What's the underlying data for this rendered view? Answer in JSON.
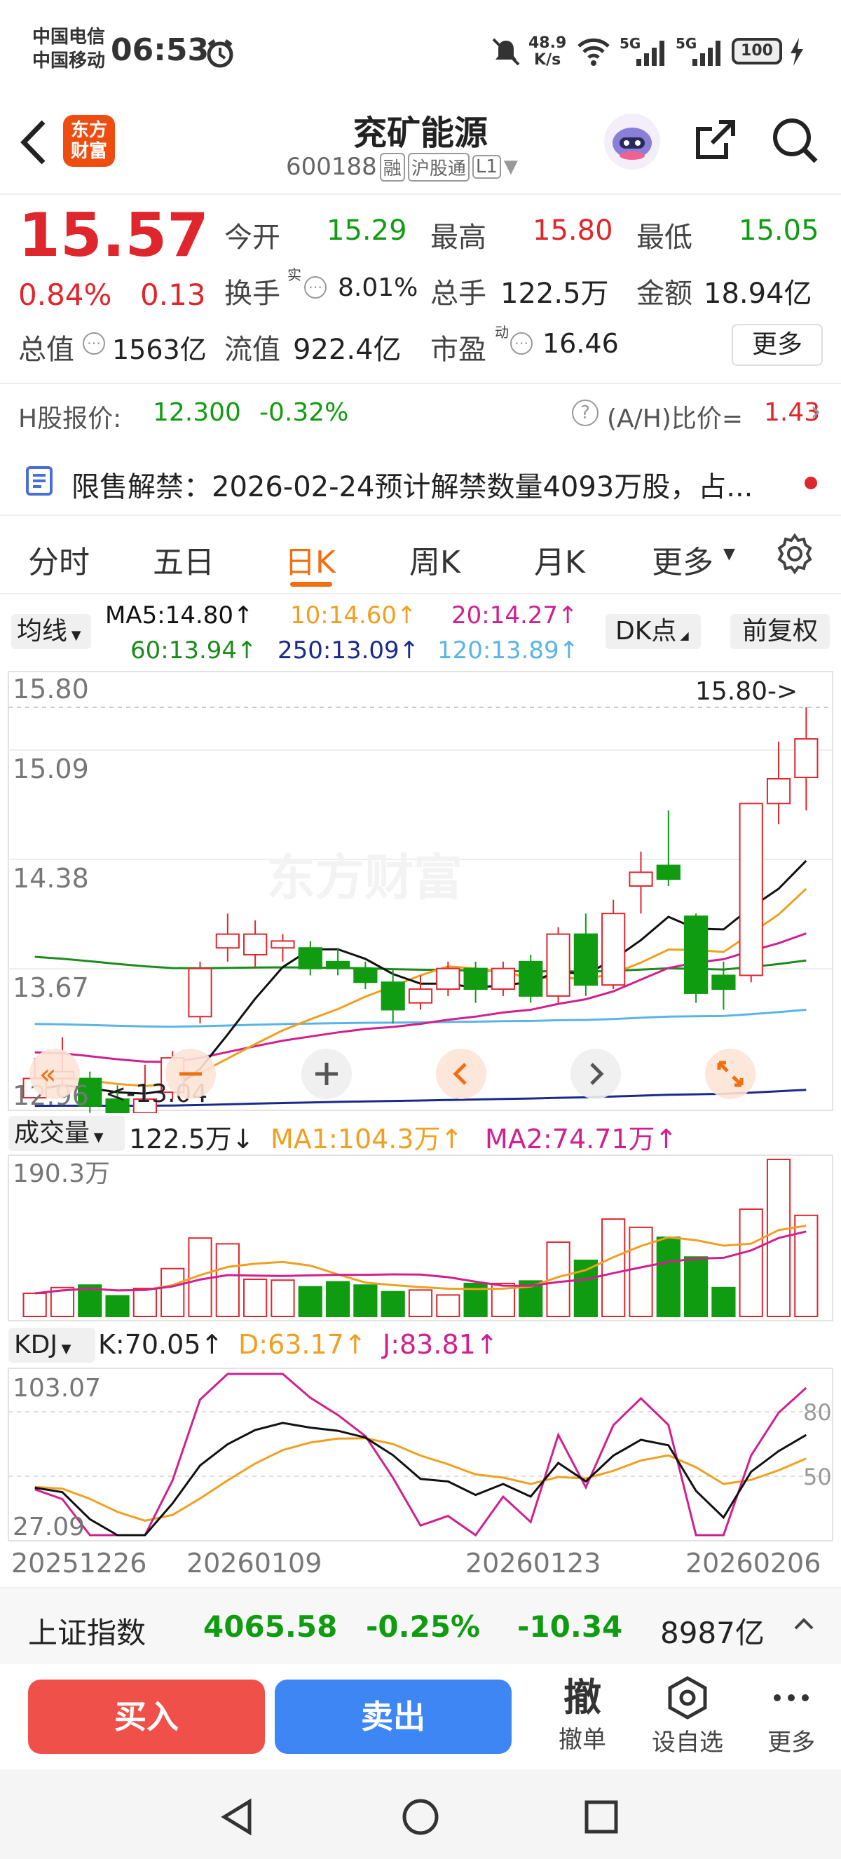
{
  "status": {
    "carrier1": "中国电信",
    "carrier2": "中国移动",
    "time": "06:53",
    "net_speed_value": "48.9",
    "net_speed_unit": "K/s",
    "battery": "100",
    "signal1": "5G",
    "signal2": "5G"
  },
  "nav": {
    "logo_line1": "东方",
    "logo_line2": "财富",
    "stock_name": "兖矿能源",
    "stock_code": "600188",
    "badge_rong": "融",
    "badge_hgt": "沪股通",
    "badge_l1": "L1"
  },
  "quote": {
    "price": "15.57",
    "change_pct": "0.84%",
    "change": "0.13",
    "open_label": "今开",
    "open": "15.29",
    "high_label": "最高",
    "high": "15.80",
    "low_label": "最低",
    "low": "15.05",
    "turnover_label": "换手",
    "turnover_sup": "实",
    "turnover": "8.01%",
    "volume_label": "总手",
    "volume": "122.5万",
    "amount_label": "金额",
    "amount": "18.94亿",
    "mktcap_label": "总值",
    "mktcap": "1563亿",
    "float_label": "流值",
    "float_cap": "922.4亿",
    "pe_label": "市盈",
    "pe_sup": "动",
    "pe": "16.46",
    "more_btn": "更多"
  },
  "hshare": {
    "label": "H股报价:",
    "price": "12.300",
    "change": "-0.32%",
    "ratio_label": "(A/H)比价=",
    "ratio": "1.43"
  },
  "notice": {
    "text": "限售解禁：2026-02-24预计解禁数量4093万股，占..."
  },
  "tabs": {
    "items": [
      "分时",
      "五日",
      "日K",
      "周K",
      "月K",
      "更多"
    ],
    "active": "日K"
  },
  "ma_legend": {
    "selector": "均线",
    "ma5": "MA5:14.80↑",
    "ma10": "10:14.60↑",
    "ma20": "20:14.27↑",
    "ma60": "60:13.94↑",
    "ma250": "250:13.09↑",
    "ma120": "120:13.89↑",
    "dk_btn": "DK点",
    "fq_btn": "前复权"
  },
  "chart_labels": {
    "y_top": "15.80",
    "y_2": "15.09",
    "y_3": "14.38",
    "y_4": "13.67",
    "y_bottom": "12.96",
    "high_mark": "15.80->",
    "low_mark": "<-13.04",
    "watermark": "东方财富"
  },
  "volume_panel": {
    "selector": "成交量",
    "value": "122.5万↓",
    "ma1": "MA1:104.3万↑",
    "ma2": "MA2:74.71万↑",
    "y_max": "190.3万"
  },
  "kdj_panel": {
    "selector": "KDJ",
    "k": "K:70.05↑",
    "d": "D:63.17↑",
    "j": "J:83.81↑",
    "y_max": "103.07",
    "y_min": "27.09",
    "ref80": "80",
    "ref50": "50"
  },
  "x_dates": [
    "20251226",
    "20260109",
    "20260123",
    "20260206"
  ],
  "index_bar": {
    "name": "上证指数",
    "value": "4065.58",
    "change_pct": "-0.25%",
    "change": "-10.34",
    "amount": "8987亿"
  },
  "actions": {
    "buy": "买入",
    "sell": "卖出",
    "cancel_icon_char": "撤",
    "cancel": "撤单",
    "watch": "设自选",
    "more": "更多"
  },
  "colors": {
    "up": "#e0262d",
    "down": "#109c10",
    "ma5": "#111111",
    "ma10": "#f0a020",
    "ma20": "#d02090",
    "ma60": "#1c8c1c",
    "ma120": "#5ab4e6",
    "ma250": "#1a2a8c",
    "accent": "#f07010"
  },
  "chart_data": {
    "type": "candlestick",
    "y_range": [
      12.96,
      15.8
    ],
    "ohlc": [
      {
        "o": 12.96,
        "h": 13.25,
        "l": 12.96,
        "c": 13.1
      },
      {
        "o": 13.1,
        "h": 13.4,
        "l": 13.05,
        "c": 13.15
      },
      {
        "o": 13.1,
        "h": 13.15,
        "l": 12.85,
        "c": 12.9
      },
      {
        "o": 12.95,
        "h": 13.05,
        "l": 12.8,
        "c": 12.85
      },
      {
        "o": 12.85,
        "h": 13.2,
        "l": 12.8,
        "c": 12.95
      },
      {
        "o": 13.0,
        "h": 13.3,
        "l": 12.95,
        "c": 13.25
      },
      {
        "o": 13.55,
        "h": 13.95,
        "l": 13.5,
        "c": 13.9
      },
      {
        "o": 14.05,
        "h": 14.3,
        "l": 13.95,
        "c": 14.15
      },
      {
        "o": 14.0,
        "h": 14.25,
        "l": 13.9,
        "c": 14.15
      },
      {
        "o": 14.05,
        "h": 14.15,
        "l": 13.95,
        "c": 14.1
      },
      {
        "o": 14.05,
        "h": 14.1,
        "l": 13.85,
        "c": 13.9
      },
      {
        "o": 13.95,
        "h": 14.05,
        "l": 13.85,
        "c": 13.9
      },
      {
        "o": 13.9,
        "h": 13.95,
        "l": 13.75,
        "c": 13.8
      },
      {
        "o": 13.8,
        "h": 13.9,
        "l": 13.5,
        "c": 13.6
      },
      {
        "o": 13.65,
        "h": 13.85,
        "l": 13.6,
        "c": 13.75
      },
      {
        "o": 13.75,
        "h": 13.95,
        "l": 13.7,
        "c": 13.9
      },
      {
        "o": 13.9,
        "h": 13.95,
        "l": 13.65,
        "c": 13.75
      },
      {
        "o": 13.75,
        "h": 13.95,
        "l": 13.7,
        "c": 13.9
      },
      {
        "o": 13.95,
        "h": 14.0,
        "l": 13.65,
        "c": 13.7
      },
      {
        "o": 13.7,
        "h": 14.2,
        "l": 13.65,
        "c": 14.15
      },
      {
        "o": 14.15,
        "h": 14.3,
        "l": 13.7,
        "c": 13.78
      },
      {
        "o": 13.78,
        "h": 14.4,
        "l": 13.75,
        "c": 14.3
      },
      {
        "o": 14.5,
        "h": 14.75,
        "l": 14.3,
        "c": 14.6
      },
      {
        "o": 14.65,
        "h": 15.05,
        "l": 14.5,
        "c": 14.55
      },
      {
        "o": 14.28,
        "h": 14.3,
        "l": 13.65,
        "c": 13.72
      },
      {
        "o": 13.85,
        "h": 13.95,
        "l": 13.6,
        "c": 13.75
      },
      {
        "o": 13.85,
        "h": 15.1,
        "l": 13.8,
        "c": 15.1
      },
      {
        "o": 15.1,
        "h": 15.55,
        "l": 14.95,
        "c": 15.28
      },
      {
        "o": 15.29,
        "h": 15.8,
        "l": 15.05,
        "c": 15.57
      }
    ],
    "volume_range": [
      0,
      190.3
    ],
    "volume": [
      28,
      35,
      38,
      25,
      34,
      58,
      95,
      88,
      45,
      44,
      36,
      42,
      38,
      30,
      32,
      26,
      40,
      40,
      43,
      90,
      68,
      118,
      108,
      96,
      72,
      35,
      130,
      190.3,
      122.5
    ],
    "kdj_range": [
      27.09,
      103.07
    ]
  }
}
